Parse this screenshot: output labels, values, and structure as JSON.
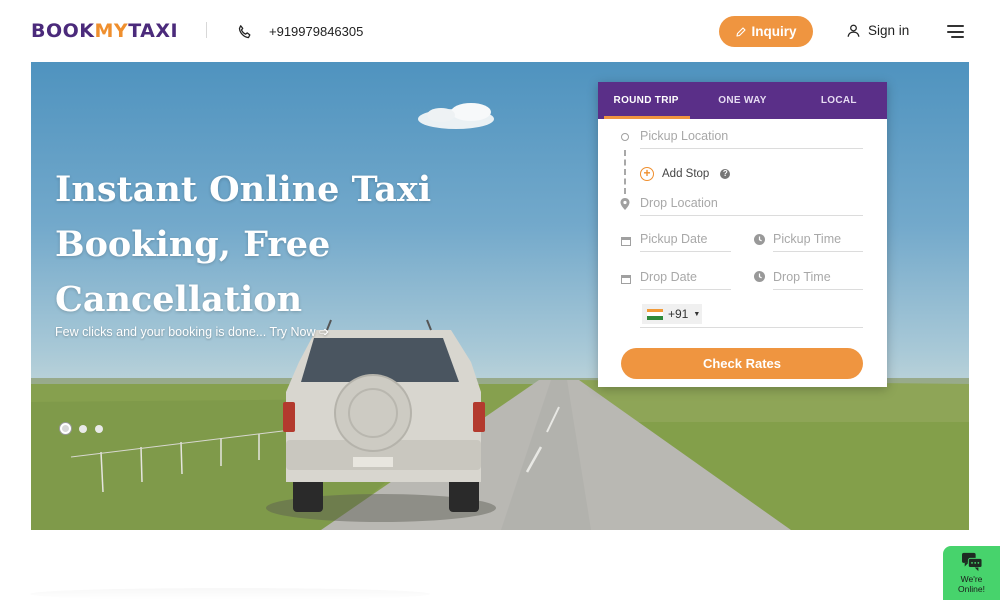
{
  "header": {
    "logo": {
      "part1": "BOOK",
      "part2": "MY",
      "part3": "TAXI"
    },
    "phone_icon": "phone-icon",
    "phone": "+919979846305",
    "inquiry_label": "Inquiry",
    "inquiry_icon": "pencil-icon",
    "signin_label": "Sign in",
    "signin_icon": "user-icon",
    "menu_icon": "hamburger-menu-icon"
  },
  "hero": {
    "title": "Instant Online Taxi Booking, Free Cancellation",
    "subtitle": "Few clicks and your booking is done... Try Now ➩",
    "slides": 3,
    "active_slide": 1
  },
  "booking": {
    "tabs": [
      {
        "label": "ROUND TRIP",
        "active": true
      },
      {
        "label": "ONE WAY",
        "active": false
      },
      {
        "label": "LOCAL",
        "active": false
      }
    ],
    "pickup_location_placeholder": "Pickup Location",
    "add_stop_label": "Add Stop",
    "drop_location_placeholder": "Drop Location",
    "pickup_date_placeholder": "Pickup Date",
    "pickup_time_placeholder": "Pickup Time",
    "drop_date_placeholder": "Drop Date",
    "drop_time_placeholder": "Drop Time",
    "country_code": "+91",
    "submit_label": "Check Rates"
  },
  "chat": {
    "label_line1": "We're",
    "label_line2": "Online!",
    "icon": "chat-bubbles-icon"
  },
  "colors": {
    "brand_purple": "#4b2a7b",
    "tab_purple": "#5a2f88",
    "accent_orange": "#ef9540",
    "chat_green": "#47d36c"
  }
}
